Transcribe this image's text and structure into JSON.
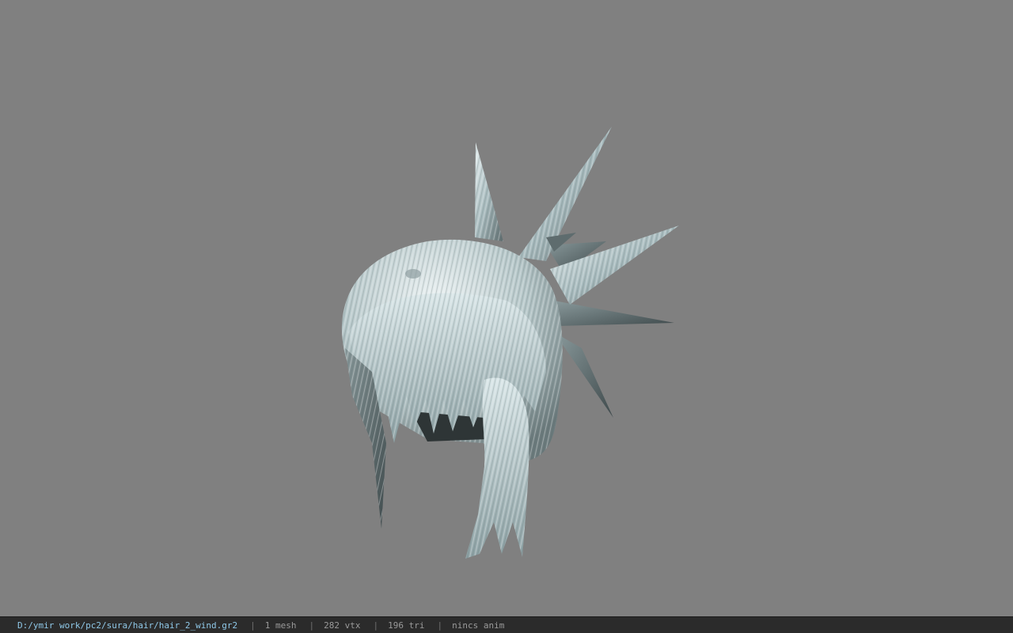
{
  "colors": {
    "viewport_bg": "#808080",
    "statusbar_bg": "#2b2b2b",
    "path_text": "#8fc8e8",
    "info_text": "#9a9a9a",
    "hair_light": "#dce8ea",
    "hair_mid": "#9fb3b6",
    "hair_dark": "#4f5c5e"
  },
  "viewport": {
    "model_icon": "hair-mesh-3d-model"
  },
  "status_bar": {
    "file_path": "D:/ymir work/pc2/sura/hair/hair_2_wind.gr2",
    "separator": "|",
    "mesh_count": "1 mesh",
    "vertex_count": "282 vtx",
    "triangle_count": "196 tri",
    "anim_info": "nincs anim"
  }
}
